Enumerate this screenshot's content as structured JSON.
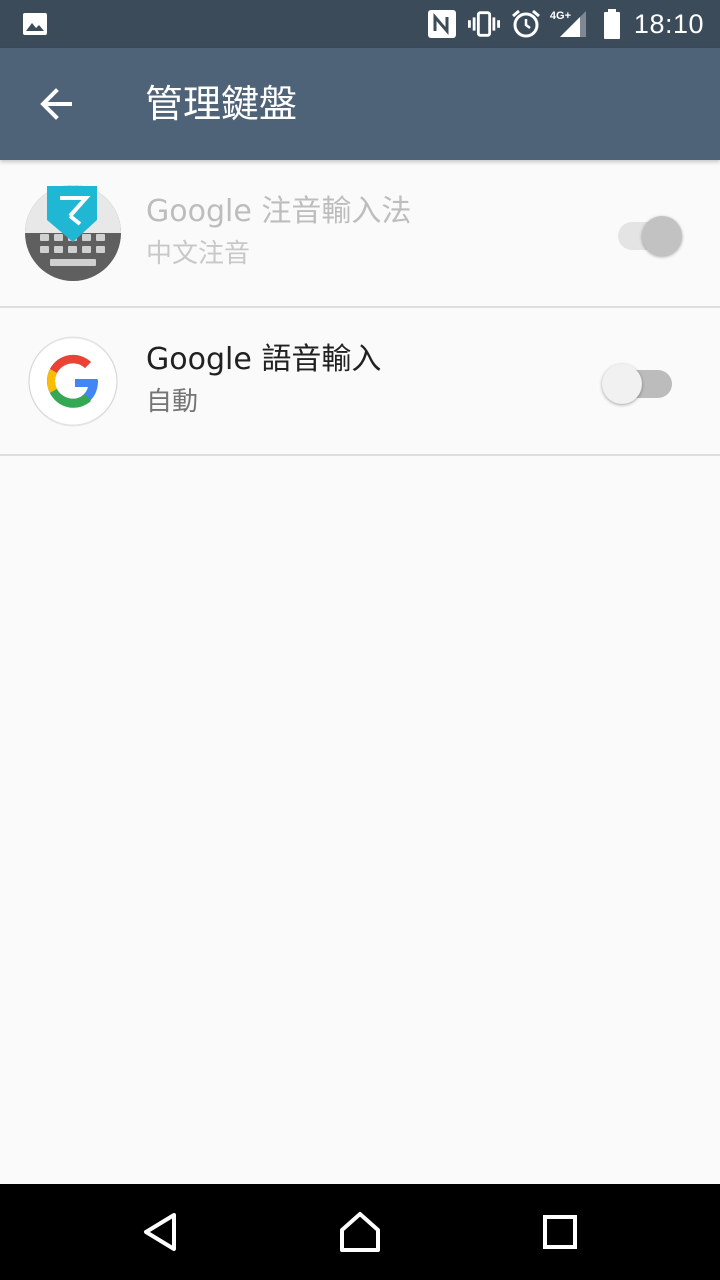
{
  "status_bar": {
    "time": "18:10",
    "network": "4G+",
    "icons": [
      "image-icon",
      "nfc-icon",
      "vibrate-icon",
      "alarm-icon",
      "signal-icon",
      "battery-icon"
    ]
  },
  "app_bar": {
    "title": "管理鍵盤",
    "back_icon": "arrow-back-icon"
  },
  "keyboards": [
    {
      "name": "Google 注音輸入法",
      "subtitle": "中文注音",
      "icon": "zhuyin-keyboard-icon",
      "icon_glyph": "ㄅ",
      "enabled": true,
      "disabled_state": true
    },
    {
      "name": "Google 語音輸入",
      "subtitle": "自動",
      "icon": "google-g-icon",
      "enabled": false,
      "disabled_state": false
    }
  ],
  "nav_bar": {
    "icons": [
      "back-triangle-icon",
      "home-icon",
      "recents-icon"
    ]
  },
  "colors": {
    "status_bar": "#3b4b5a",
    "app_bar": "#4f6378",
    "zhuyin_badge": "#1fb7d4",
    "background": "#fafafa"
  }
}
